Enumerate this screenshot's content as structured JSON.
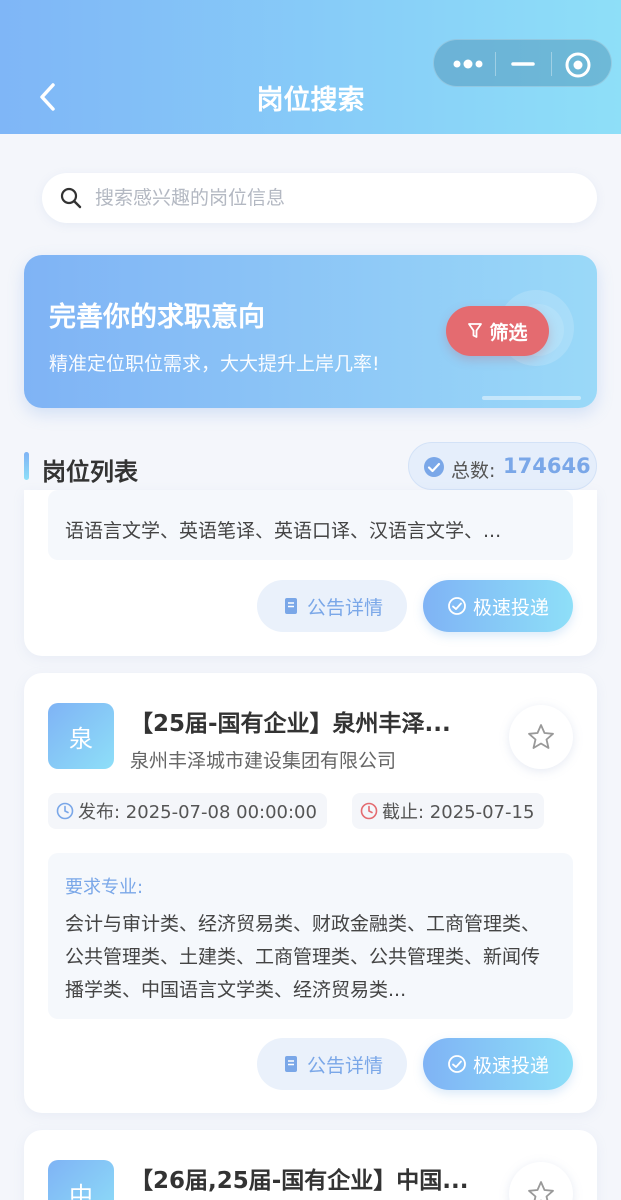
{
  "header": {
    "title": "岗位搜索"
  },
  "search": {
    "placeholder": "搜索感兴趣的岗位信息"
  },
  "banner": {
    "title": "完善你的求职意向",
    "subtitle": "精准定位职位需求，大大提升上岸几率!",
    "filter_label": "筛选"
  },
  "list": {
    "title": "岗位列表",
    "total_label": "总数:",
    "total_value": "174646"
  },
  "jobs": [
    {
      "majors_text": "语语言文学、英语笔译、英语口译、汉语言文学、...",
      "notice_label": "公告详情",
      "apply_label": "极速投递"
    },
    {
      "logo_char": "泉",
      "title": "【25届-国有企业】泉州丰泽...",
      "company": "泉州丰泽城市建设集团有限公司",
      "publish": "发布: 2025-07-08 00:00:00",
      "deadline": "截止: 2025-07-15",
      "majors_label": "要求专业:",
      "majors_text": "会计与审计类、经济贸易类、财政金融类、工商管理类、公共管理类、土建类、工商管理类、公共管理类、新闻传播学类、中国语言文学类、经济贸易类...",
      "notice_label": "公告详情",
      "apply_label": "极速投递"
    },
    {
      "logo_char": "中",
      "title": "【26届,25届-国有企业】中国..."
    }
  ],
  "colors": {
    "accent": "#7aa7e8",
    "gradient_start": "#7fb3f5",
    "gradient_end": "#8edff8",
    "filter": "#e46b70",
    "deadline_icon": "#e46b70"
  }
}
